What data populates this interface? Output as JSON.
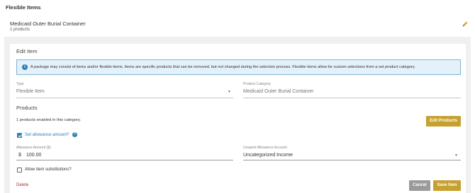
{
  "page": {
    "section_title": "Flexible Items"
  },
  "item": {
    "name": "Medicaid Outer Burial Container",
    "count": "1 products"
  },
  "icons": {
    "edit": "pencil-icon",
    "info": "info-icon",
    "help": "help-icon",
    "dropdown": "caret-down-icon"
  },
  "colors": {
    "accent_gold": "#c6a12e",
    "info_blue": "#2f7fb5",
    "info_bg": "#e4f1fa",
    "delete_red": "#a33a2a",
    "cancel_grey": "#9a9a9a"
  },
  "edit_item": {
    "title": "Edit Item",
    "info_icon_glyph": "i",
    "info_text": "A package may consist of items and/or flexible items. Items are specific products that can be removed, but not changed during the selection process. Flexible items allow for custom selections from a set product category.",
    "type": {
      "label": "Type",
      "value": "Flexible Item"
    },
    "product_category": {
      "label": "Product Category",
      "value": "Medicaid Outer Burial Container"
    },
    "products_heading": "Products",
    "enabled_text": "1 products enabled in this category.",
    "edit_products_label": "Edit Products",
    "set_allowance": {
      "label": "Set allowance amount?",
      "checked": true,
      "help_glyph": "?"
    },
    "allowance_amount": {
      "label": "Allowance Amount ($)",
      "currency": "$",
      "value": "100.00"
    },
    "unspent_account": {
      "label": "Unspent Allowance Account",
      "value": "Uncategorized Income"
    },
    "allow_substitutions": {
      "label": "Allow item substitutions?",
      "checked": false
    },
    "delete_label": "Delete",
    "cancel_label": "Cancel",
    "save_label": "Save Item"
  }
}
